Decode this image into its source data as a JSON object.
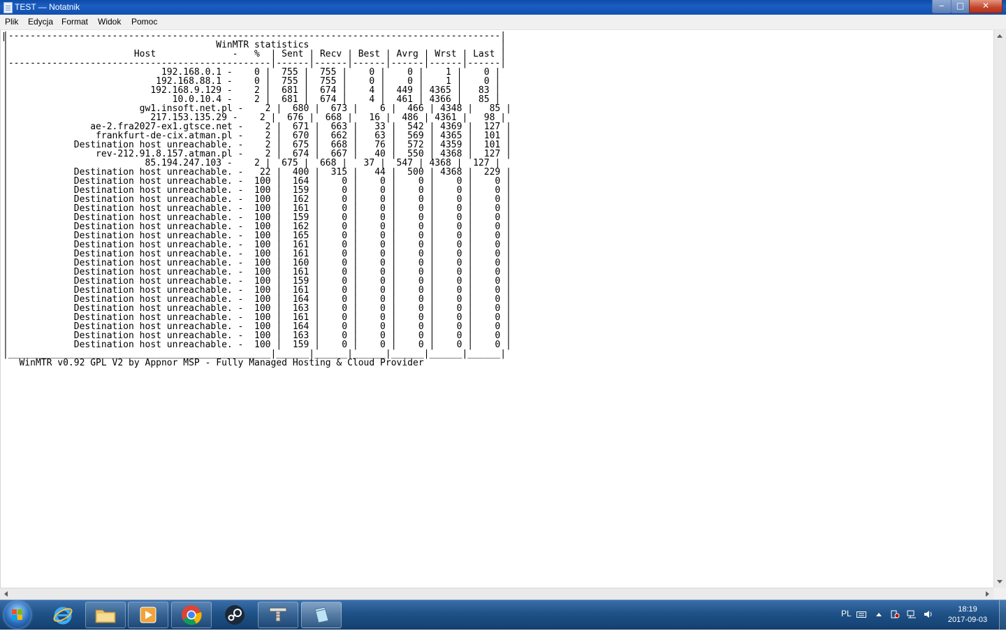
{
  "window": {
    "title": "TEST — Notatnik",
    "buttons": {
      "minimize": "‒",
      "maximize": "□",
      "close": "✕"
    }
  },
  "menu": [
    "Plik",
    "Edycja",
    "Format",
    "Widok",
    "Pomoc"
  ],
  "document": {
    "content": "|------------------------------------------------------------------------------------------|\n|                                      WinMTR statistics                                   |\n|                       Host              -   %  | Sent | Recv | Best | Avrg | Wrst | Last |\n|------------------------------------------------|------|------|------|------|------|------|\n|                            192.168.0.1 -    0 |  755 |  755 |    0 |    0 |    1 |    0 |\n|                           192.168.88.1 -    0 |  755 |  755 |    0 |    0 |    1 |    0 |\n|                          192.168.9.129 -    2 |  681 |  674 |    4 |  449 | 4365 |   83 |\n|                              10.0.10.4 -    2 |  681 |  674 |    4 |  461 | 4366 |   85 |\n|                        gw1.insoft.net.pl -    2 |  680 |  673 |    6 |  466 | 4348 |   85 |\n|                          217.153.135.29 -    2 |  676 |  668 |   16 |  486 | 4361 |   98 |\n|               ae-2.fra2027-ex1.gtsce.net -    2 |  671 |  663 |   33 |  542 | 4369 |  127 |\n|                frankfurt-de-cix.atman.pl -    2 |  670 |  662 |   63 |  569 | 4365 |  101 |\n|            Destination host unreachable. -    2 |  675 |  668 |   76 |  572 | 4359 |  101 |\n|                rev-212.91.8.157.atman.pl -    2 |  674 |  667 |   40 |  550 | 4368 |  127 |\n|                         85.194.247.103 -    2 |  675 |  668 |   37 |  547 | 4368 |  127 |\n|            Destination host unreachable. -   22 |  400 |  315 |   44 |  500 | 4368 |  229 |\n|            Destination host unreachable. -  100 |  164 |    0 |    0 |    0 |    0 |    0 |\n|            Destination host unreachable. -  100 |  159 |    0 |    0 |    0 |    0 |    0 |\n|            Destination host unreachable. -  100 |  162 |    0 |    0 |    0 |    0 |    0 |\n|            Destination host unreachable. -  100 |  161 |    0 |    0 |    0 |    0 |    0 |\n|            Destination host unreachable. -  100 |  159 |    0 |    0 |    0 |    0 |    0 |\n|            Destination host unreachable. -  100 |  162 |    0 |    0 |    0 |    0 |    0 |\n|            Destination host unreachable. -  100 |  165 |    0 |    0 |    0 |    0 |    0 |\n|            Destination host unreachable. -  100 |  161 |    0 |    0 |    0 |    0 |    0 |\n|            Destination host unreachable. -  100 |  161 |    0 |    0 |    0 |    0 |    0 |\n|            Destination host unreachable. -  100 |  160 |    0 |    0 |    0 |    0 |    0 |\n|            Destination host unreachable. -  100 |  161 |    0 |    0 |    0 |    0 |    0 |\n|            Destination host unreachable. -  100 |  159 |    0 |    0 |    0 |    0 |    0 |\n|            Destination host unreachable. -  100 |  161 |    0 |    0 |    0 |    0 |    0 |\n|            Destination host unreachable. -  100 |  164 |    0 |    0 |    0 |    0 |    0 |\n|            Destination host unreachable. -  100 |  163 |    0 |    0 |    0 |    0 |    0 |\n|            Destination host unreachable. -  100 |  161 |    0 |    0 |    0 |    0 |    0 |\n|            Destination host unreachable. -  100 |  164 |    0 |    0 |    0 |    0 |    0 |\n|            Destination host unreachable. -  100 |  163 |    0 |    0 |    0 |    0 |    0 |\n|            Destination host unreachable. -  100 |  159 |    0 |    0 |    0 |    0 |    0 |\n|________________________________________________|______|______|______|______|______|______|\n   WinMTR v0.92 GPL V2 by Appnor MSP - Fully Managed Hosting & Cloud Provider"
  },
  "taskbar": {
    "apps": [
      {
        "name": "internet-explorer",
        "icon": "ie-icon"
      },
      {
        "name": "file-explorer",
        "icon": "folder-icon"
      },
      {
        "name": "media-player",
        "icon": "media-player-icon"
      },
      {
        "name": "chrome",
        "icon": "chrome-icon"
      },
      {
        "name": "steam",
        "icon": "steam-icon"
      },
      {
        "name": "winmtr",
        "icon": "network-icon"
      },
      {
        "name": "notepad",
        "icon": "notepad-icon",
        "active": true
      }
    ]
  },
  "tray": {
    "language": "PL",
    "time": "18:19",
    "date": "2017-09-03"
  }
}
